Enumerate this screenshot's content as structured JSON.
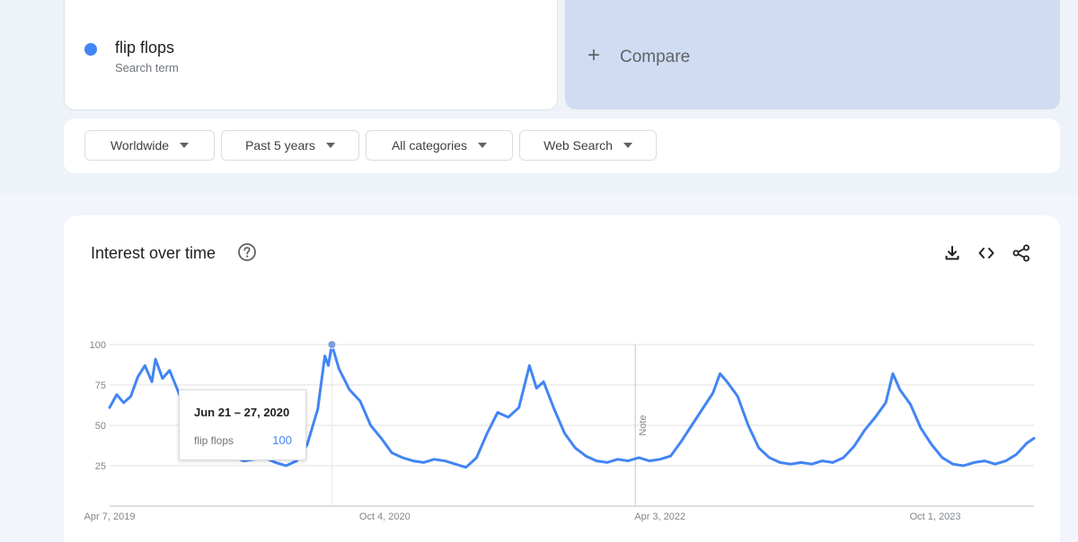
{
  "search": {
    "term": "flip flops",
    "term_sublabel": "Search term",
    "term_color": "#4285f4",
    "compare_label": "Compare",
    "compare_icon": "plus-icon"
  },
  "filters": {
    "region": "Worldwide",
    "time_range": "Past 5 years",
    "category": "All categories",
    "search_type": "Web Search"
  },
  "panel": {
    "title": "Interest over time",
    "help_icon": "help-circle-icon",
    "actions": [
      "download-icon",
      "embed-code-icon",
      "share-icon"
    ]
  },
  "tooltip": {
    "date": "Jun 21 – 27, 2020",
    "series": "flip flops",
    "value": "100"
  },
  "chart_data": {
    "type": "line",
    "series_color": "#4285f4",
    "grid": true,
    "ylim": [
      0,
      100
    ],
    "y_ticks": [
      100,
      75,
      50,
      25
    ],
    "x_tick_labels": [
      "Apr 7, 2019",
      "Oct 4, 2020",
      "Apr 3, 2022",
      "Oct 1, 2023"
    ],
    "annotation": "Note",
    "series": [
      {
        "name": "flip flops",
        "points": [
          [
            "2019-04-07",
            61
          ],
          [
            "2019-04-21",
            69
          ],
          [
            "2019-05-05",
            64
          ],
          [
            "2019-05-19",
            68
          ],
          [
            "2019-06-02",
            80
          ],
          [
            "2019-06-16",
            87
          ],
          [
            "2019-06-30",
            77
          ],
          [
            "2019-07-07",
            91
          ],
          [
            "2019-07-21",
            79
          ],
          [
            "2019-08-04",
            84
          ],
          [
            "2019-08-25",
            68
          ],
          [
            "2019-09-15",
            55
          ],
          [
            "2019-10-06",
            46
          ],
          [
            "2019-10-27",
            37
          ],
          [
            "2019-11-17",
            34
          ],
          [
            "2019-12-08",
            31
          ],
          [
            "2019-12-29",
            28
          ],
          [
            "2020-01-19",
            29
          ],
          [
            "2020-02-09",
            30
          ],
          [
            "2020-03-01",
            27
          ],
          [
            "2020-03-22",
            25
          ],
          [
            "2020-04-12",
            28
          ],
          [
            "2020-05-03",
            38
          ],
          [
            "2020-05-24",
            60
          ],
          [
            "2020-06-07",
            93
          ],
          [
            "2020-06-14",
            87
          ],
          [
            "2020-06-21",
            100
          ],
          [
            "2020-07-05",
            85
          ],
          [
            "2020-07-26",
            72
          ],
          [
            "2020-08-16",
            65
          ],
          [
            "2020-09-06",
            50
          ],
          [
            "2020-09-27",
            42
          ],
          [
            "2020-10-18",
            33
          ],
          [
            "2020-11-08",
            30
          ],
          [
            "2020-11-29",
            28
          ],
          [
            "2020-12-20",
            27
          ],
          [
            "2021-01-10",
            29
          ],
          [
            "2021-01-31",
            28
          ],
          [
            "2021-02-21",
            26
          ],
          [
            "2021-03-14",
            24
          ],
          [
            "2021-04-04",
            30
          ],
          [
            "2021-04-25",
            45
          ],
          [
            "2021-05-16",
            58
          ],
          [
            "2021-06-06",
            55
          ],
          [
            "2021-06-27",
            61
          ],
          [
            "2021-07-18",
            87
          ],
          [
            "2021-08-01",
            73
          ],
          [
            "2021-08-15",
            77
          ],
          [
            "2021-09-05",
            60
          ],
          [
            "2021-09-26",
            45
          ],
          [
            "2021-10-17",
            36
          ],
          [
            "2021-11-07",
            31
          ],
          [
            "2021-11-28",
            28
          ],
          [
            "2021-12-19",
            27
          ],
          [
            "2022-01-09",
            29
          ],
          [
            "2022-01-30",
            28
          ],
          [
            "2022-02-20",
            30
          ],
          [
            "2022-03-13",
            28
          ],
          [
            "2022-04-03",
            29
          ],
          [
            "2022-04-24",
            31
          ],
          [
            "2022-05-15",
            40
          ],
          [
            "2022-06-05",
            50
          ],
          [
            "2022-06-26",
            60
          ],
          [
            "2022-07-17",
            70
          ],
          [
            "2022-07-31",
            82
          ],
          [
            "2022-08-14",
            77
          ],
          [
            "2022-09-04",
            68
          ],
          [
            "2022-09-25",
            50
          ],
          [
            "2022-10-16",
            36
          ],
          [
            "2022-11-06",
            30
          ],
          [
            "2022-11-27",
            27
          ],
          [
            "2022-12-18",
            26
          ],
          [
            "2023-01-08",
            27
          ],
          [
            "2023-01-29",
            26
          ],
          [
            "2023-02-19",
            28
          ],
          [
            "2023-03-12",
            27
          ],
          [
            "2023-04-02",
            30
          ],
          [
            "2023-04-23",
            37
          ],
          [
            "2023-05-14",
            47
          ],
          [
            "2023-06-04",
            55
          ],
          [
            "2023-06-25",
            64
          ],
          [
            "2023-07-09",
            82
          ],
          [
            "2023-07-23",
            72
          ],
          [
            "2023-08-13",
            63
          ],
          [
            "2023-09-03",
            48
          ],
          [
            "2023-09-24",
            38
          ],
          [
            "2023-10-15",
            30
          ],
          [
            "2023-11-05",
            26
          ],
          [
            "2023-11-26",
            25
          ],
          [
            "2023-12-17",
            27
          ],
          [
            "2024-01-07",
            28
          ],
          [
            "2024-01-28",
            26
          ],
          [
            "2024-02-18",
            28
          ],
          [
            "2024-03-10",
            32
          ],
          [
            "2024-03-31",
            39
          ],
          [
            "2024-04-14",
            42
          ]
        ]
      }
    ],
    "highlight_point": [
      "2020-06-21",
      100
    ]
  }
}
